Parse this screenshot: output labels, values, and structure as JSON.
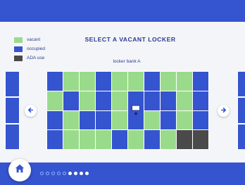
{
  "title": "SELECT A VACANT LOCKER",
  "bank_label": "locker bank A",
  "legend": [
    {
      "label": "vacant",
      "color": "#9adb8b"
    },
    {
      "label": "occupied",
      "color": "#3554cf"
    },
    {
      "label": "ADA use",
      "color": "#4a4a4a"
    }
  ],
  "nav": {
    "prev_icon": "arrow-left-icon",
    "next_icon": "arrow-right-icon",
    "home_icon": "home-icon"
  },
  "lockers": [
    "occupied",
    "vacant",
    "vacant",
    "occupied",
    "vacant",
    "vacant",
    "occupied",
    "vacant",
    "vacant",
    "occupied",
    "vacant",
    "occupied",
    "vacant",
    "occupied",
    "vacant",
    "kiosk",
    "occupied",
    "occupied",
    "vacant",
    "occupied",
    "occupied",
    "vacant",
    "occupied",
    "occupied",
    "vacant",
    "kiosk",
    "vacant",
    "occupied",
    "vacant",
    "occupied",
    "occupied",
    "vacant",
    "vacant",
    "vacant",
    "occupied",
    "vacant",
    "occupied",
    "vacant",
    "ada",
    "ada"
  ],
  "pagination": {
    "total": 9,
    "current": 6
  }
}
